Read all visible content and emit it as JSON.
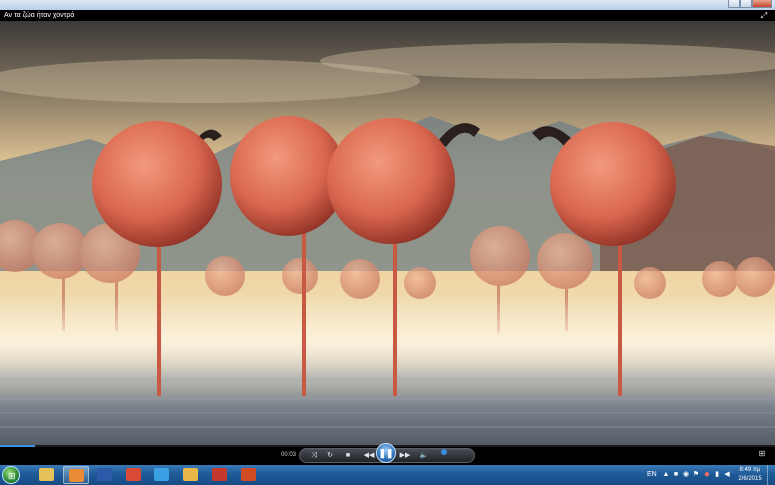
{
  "window": {
    "title": "Αν τα ζώα ήταν χοντρά"
  },
  "player": {
    "elapsed": "00:03",
    "progress_fraction": 0.045,
    "volume_fraction": 0.3,
    "buttons": {
      "shuffle": "⤨",
      "repeat": "↻",
      "stop": "■",
      "previous": "◀◀",
      "play_pause": "❚❚",
      "next": "▶▶",
      "mute": "🔈",
      "fullscreen": "⤢",
      "switch_view": "⊞"
    }
  },
  "video": {
    "colors": {
      "sky_top": "#3b3a36",
      "sky_glow": "#f0d29a",
      "mountain": "#6f7f86",
      "water": "#6c7480",
      "flamingo": "#d9664e"
    }
  },
  "taskbar": {
    "start_icon": "windows-flag-icon",
    "apps": [
      {
        "name": "explorer-icon",
        "color": "#e5c15a",
        "active": false
      },
      {
        "name": "media-player-icon",
        "color": "#e98a35",
        "active": true
      },
      {
        "name": "word-icon",
        "color": "#2d5aa8",
        "active": false
      },
      {
        "name": "chrome-icon",
        "color": "#d94a37",
        "active": false
      },
      {
        "name": "internet-explorer-icon",
        "color": "#3aa0e3",
        "active": false
      },
      {
        "name": "paint-icon",
        "color": "#e8b84a",
        "active": false
      },
      {
        "name": "app-red-icon",
        "color": "#c6372c",
        "active": false
      },
      {
        "name": "powerpoint-icon",
        "color": "#d04a23",
        "active": false
      }
    ],
    "language": "EN",
    "clock_time": "8:49 πμ",
    "clock_date": "2/6/2015"
  }
}
